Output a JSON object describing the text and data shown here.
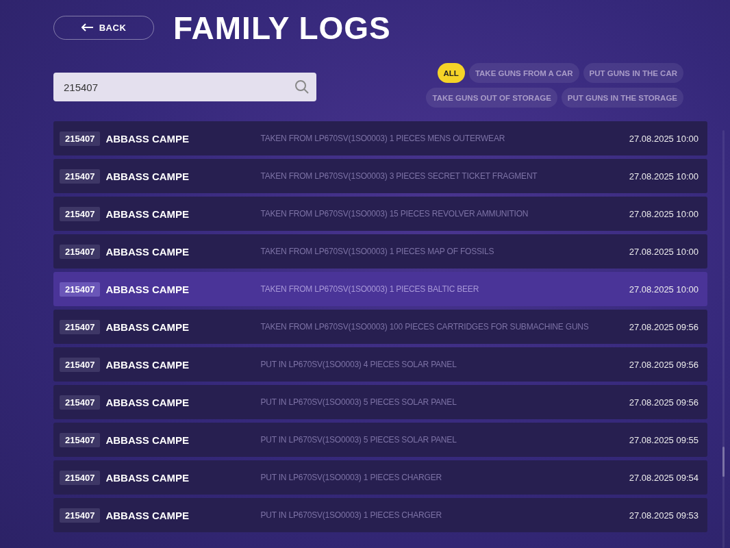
{
  "back_button": {
    "label": "BACK"
  },
  "title": "FAMILY LOGS",
  "search": {
    "value": "215407"
  },
  "filters": [
    {
      "label": "ALL",
      "selected": true
    },
    {
      "label": "TAKE GUNS FROM A CAR",
      "selected": false
    },
    {
      "label": "PUT GUNS IN THE CAR",
      "selected": false
    },
    {
      "label": "TAKE GUNS OUT OF STORAGE",
      "selected": false
    },
    {
      "label": "PUT GUNS IN THE STORAGE",
      "selected": false
    }
  ],
  "logs": [
    {
      "id": "215407",
      "name": "ABBASS CAMPE",
      "action": "TAKEN FROM LP670SV(1SO0003) 1 PIECES MENS OUTERWEAR",
      "time": "27.08.2025 10:00",
      "selected": false
    },
    {
      "id": "215407",
      "name": "ABBASS CAMPE",
      "action": "TAKEN FROM LP670SV(1SO0003) 3 PIECES SECRET TICKET FRAGMENT",
      "time": "27.08.2025 10:00",
      "selected": false
    },
    {
      "id": "215407",
      "name": "ABBASS CAMPE",
      "action": "TAKEN FROM LP670SV(1SO0003) 15 PIECES REVOLVER AMMUNITION",
      "time": "27.08.2025 10:00",
      "selected": false
    },
    {
      "id": "215407",
      "name": "ABBASS CAMPE",
      "action": "TAKEN FROM LP670SV(1SO0003) 1 PIECES MAP OF FOSSILS",
      "time": "27.08.2025 10:00",
      "selected": false
    },
    {
      "id": "215407",
      "name": "ABBASS CAMPE",
      "action": "TAKEN FROM LP670SV(1SO0003) 1 PIECES BALTIC BEER",
      "time": "27.08.2025 10:00",
      "selected": true
    },
    {
      "id": "215407",
      "name": "ABBASS CAMPE",
      "action": "TAKEN FROM LP670SV(1SO0003) 100 PIECES CARTRIDGES FOR SUBMACHINE GUNS",
      "time": "27.08.2025 09:56",
      "selected": false
    },
    {
      "id": "215407",
      "name": "ABBASS CAMPE",
      "action": "PUT IN LP670SV(1SO0003) 4 PIECES SOLAR PANEL",
      "time": "27.08.2025 09:56",
      "selected": false
    },
    {
      "id": "215407",
      "name": "ABBASS CAMPE",
      "action": "PUT IN LP670SV(1SO0003) 5 PIECES SOLAR PANEL",
      "time": "27.08.2025 09:56",
      "selected": false
    },
    {
      "id": "215407",
      "name": "ABBASS CAMPE",
      "action": "PUT IN LP670SV(1SO0003) 5 PIECES SOLAR PANEL",
      "time": "27.08.2025 09:55",
      "selected": false
    },
    {
      "id": "215407",
      "name": "ABBASS CAMPE",
      "action": "PUT IN LP670SV(1SO0003) 1 PIECES CHARGER",
      "time": "27.08.2025 09:54",
      "selected": false
    },
    {
      "id": "215407",
      "name": "ABBASS CAMPE",
      "action": "PUT IN LP670SV(1SO0003) 1 PIECES CHARGER",
      "time": "27.08.2025 09:53",
      "selected": false
    }
  ]
}
